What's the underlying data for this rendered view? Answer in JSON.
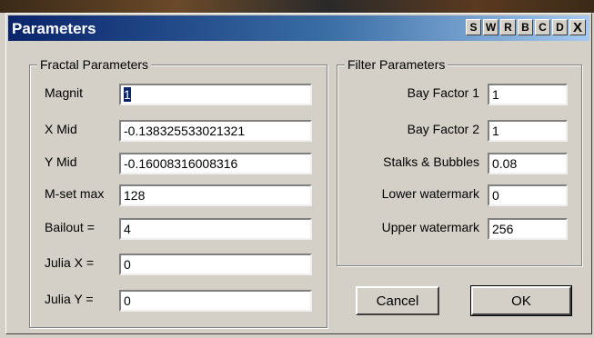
{
  "window": {
    "title": "Parameters",
    "title_buttons": [
      "S",
      "W",
      "R",
      "B",
      "C",
      "D"
    ],
    "close_glyph": "X"
  },
  "fractal": {
    "group_label": "Fractal Parameters",
    "fields": [
      {
        "label": "Magnit",
        "value": "1"
      },
      {
        "label": "X Mid",
        "value": "-0.138325533021321"
      },
      {
        "label": "Y Mid",
        "value": "-0.16008316008316"
      },
      {
        "label": "M-set max",
        "value": "128"
      },
      {
        "label": "Bailout =",
        "value": "4"
      },
      {
        "label": "Julia X =",
        "value": "0"
      },
      {
        "label": "Julia Y =",
        "value": "0"
      }
    ]
  },
  "filter": {
    "group_label": "Filter Parameters",
    "fields": [
      {
        "label": "Bay Factor 1",
        "value": "1"
      },
      {
        "label": "Bay Factor 2",
        "value": "1"
      },
      {
        "label": "Stalks & Bubbles",
        "value": "0.08"
      },
      {
        "label": "Lower watermark",
        "value": "0"
      },
      {
        "label": "Upper watermark",
        "value": "256"
      }
    ]
  },
  "buttons": {
    "cancel": "Cancel",
    "ok": "OK"
  }
}
